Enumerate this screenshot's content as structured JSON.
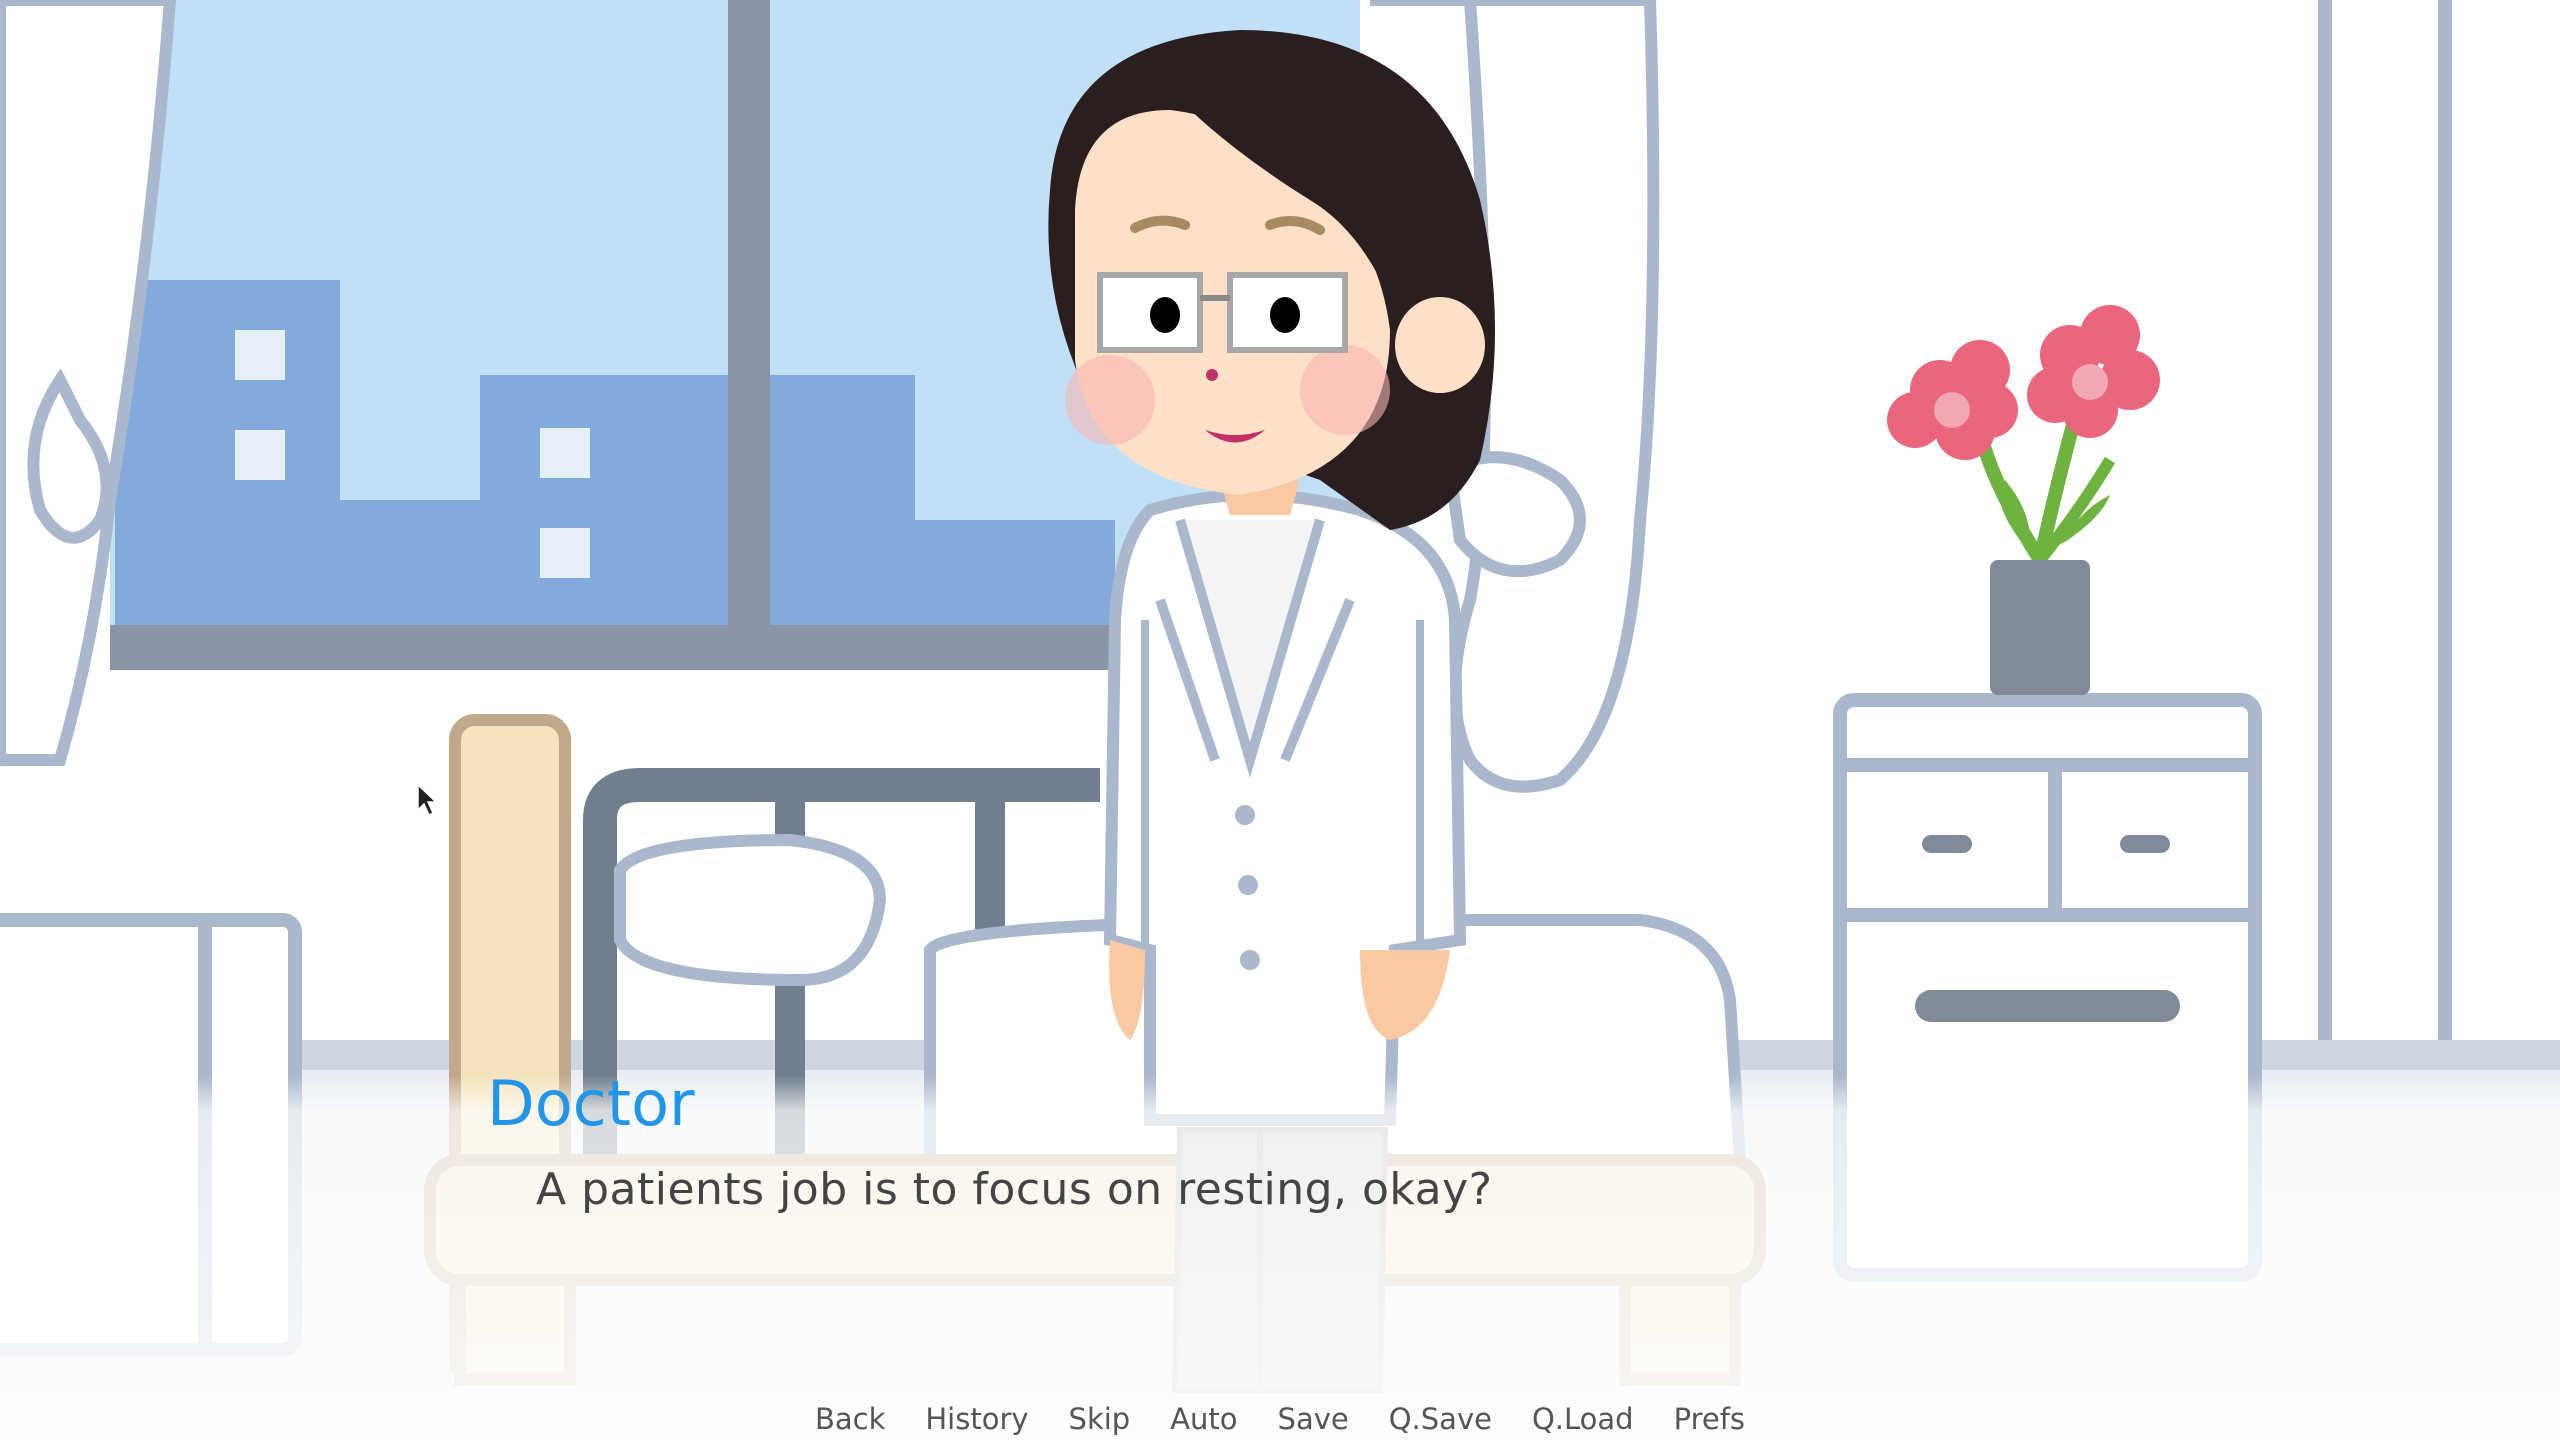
{
  "speaker": "Doctor",
  "dialogue": "A patients job is to focus on resting, okay?",
  "quick_menu": [
    {
      "label": "Back"
    },
    {
      "label": "History"
    },
    {
      "label": "Skip"
    },
    {
      "label": "Auto"
    },
    {
      "label": "Save"
    },
    {
      "label": "Q.Save"
    },
    {
      "label": "Q.Load"
    },
    {
      "label": "Prefs"
    }
  ],
  "colors": {
    "speaker": "#2196e8",
    "dialogue": "#444444",
    "menu": "#555555",
    "sky": "#bfe0f7",
    "outline": "#a9b8cc"
  }
}
